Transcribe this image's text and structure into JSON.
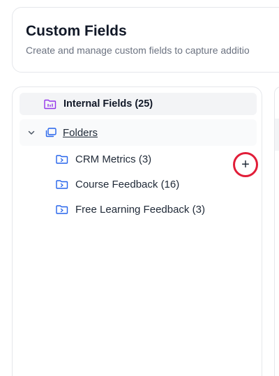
{
  "header": {
    "title": "Custom Fields",
    "subtitle": "Create and manage custom fields to capture additio"
  },
  "sidebar": {
    "internal_fields": {
      "label": "Internal Fields (25)",
      "icon": "internal-fields-icon"
    },
    "folders": {
      "label": "Folders",
      "expanded": true,
      "add_label": "+",
      "items": [
        {
          "label": "CRM Metrics (3)"
        },
        {
          "label": "Course Feedback (16)"
        },
        {
          "label": "Free Learning Feedback (3)"
        }
      ]
    }
  },
  "colors": {
    "accent_purple": "#9333ea",
    "folder_blue": "#2563eb",
    "highlight_red": "#e11d38"
  }
}
